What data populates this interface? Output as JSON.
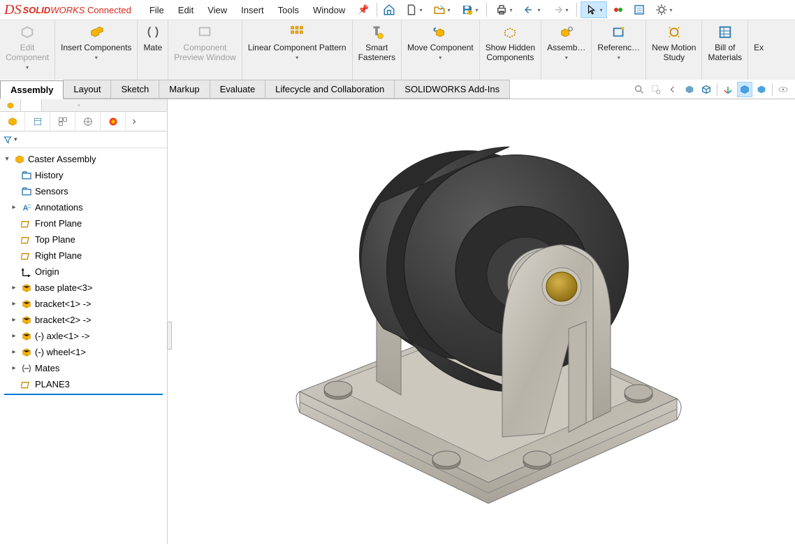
{
  "app": {
    "brand_bold": "SOLID",
    "brand_rest": "WORKS",
    "status": "Connected"
  },
  "menu": {
    "items": [
      "File",
      "Edit",
      "View",
      "Insert",
      "Tools",
      "Window"
    ]
  },
  "ribbon": {
    "items": [
      {
        "label": "Edit\nComponent",
        "disabled": true,
        "dd": true
      },
      {
        "label": "Insert Components",
        "dd": true
      },
      {
        "label": "Mate"
      },
      {
        "label": "Component\nPreview Window",
        "disabled": true
      },
      {
        "label": "Linear Component Pattern",
        "dd": true
      },
      {
        "label": "Smart\nFasteners"
      },
      {
        "label": "Move Component",
        "dd": true
      },
      {
        "label": "Show Hidden\nComponents"
      },
      {
        "label": "Assemb…",
        "dd": true
      },
      {
        "label": "Referenc…",
        "dd": true
      },
      {
        "label": "New Motion\nStudy"
      },
      {
        "label": "Bill of\nMaterials"
      },
      {
        "label": "Ex"
      }
    ]
  },
  "tabs": {
    "items": [
      "Assembly",
      "Layout",
      "Sketch",
      "Markup",
      "Evaluate",
      "Lifecycle and Collaboration",
      "SOLIDWORKS Add-Ins"
    ],
    "active": 0
  },
  "tree": {
    "root": "Caster Assembly",
    "nodes": [
      {
        "label": "History",
        "icon": "folder",
        "exp": ""
      },
      {
        "label": "Sensors",
        "icon": "folder",
        "exp": ""
      },
      {
        "label": "Annotations",
        "icon": "annot",
        "exp": "▸"
      },
      {
        "label": "Front Plane",
        "icon": "plane"
      },
      {
        "label": "Top Plane",
        "icon": "plane"
      },
      {
        "label": "Right Plane",
        "icon": "plane"
      },
      {
        "label": "Origin",
        "icon": "origin"
      },
      {
        "label": "base plate<3>",
        "icon": "part",
        "exp": "▸"
      },
      {
        "label": "bracket<1> ->",
        "icon": "part",
        "exp": "▸"
      },
      {
        "label": "bracket<2> ->",
        "icon": "part",
        "exp": "▸"
      },
      {
        "label": "(-) axle<1> ->",
        "icon": "part",
        "exp": "▸"
      },
      {
        "label": "(-) wheel<1>",
        "icon": "part",
        "exp": "▸"
      },
      {
        "label": "Mates",
        "icon": "mates",
        "exp": "▸"
      },
      {
        "label": "PLANE3",
        "icon": "plane"
      }
    ]
  }
}
